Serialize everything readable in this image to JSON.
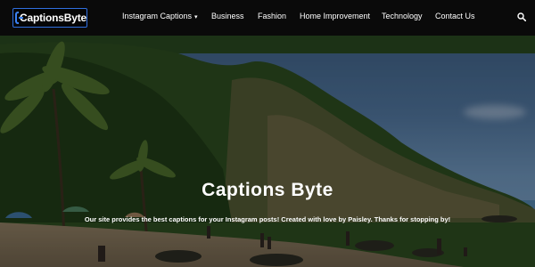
{
  "logo": {
    "text": "CaptionsByte"
  },
  "nav": {
    "items": [
      "Instagram Captions",
      "Business",
      "Fashion",
      "Home Improvement",
      "Technology",
      "Contact Us"
    ]
  },
  "hero": {
    "title": "Captions Byte",
    "subtitle": "Our site provides the best captions for your Instagram posts! Created with love by Paisley. Thanks for stopping by!"
  },
  "icons": {
    "search": "search-icon",
    "dropdown": "chevron-down-icon"
  },
  "colors": {
    "header_bg": "#0a0a0a",
    "logo_accent": "#3b82f6",
    "text": "#ffffff"
  }
}
